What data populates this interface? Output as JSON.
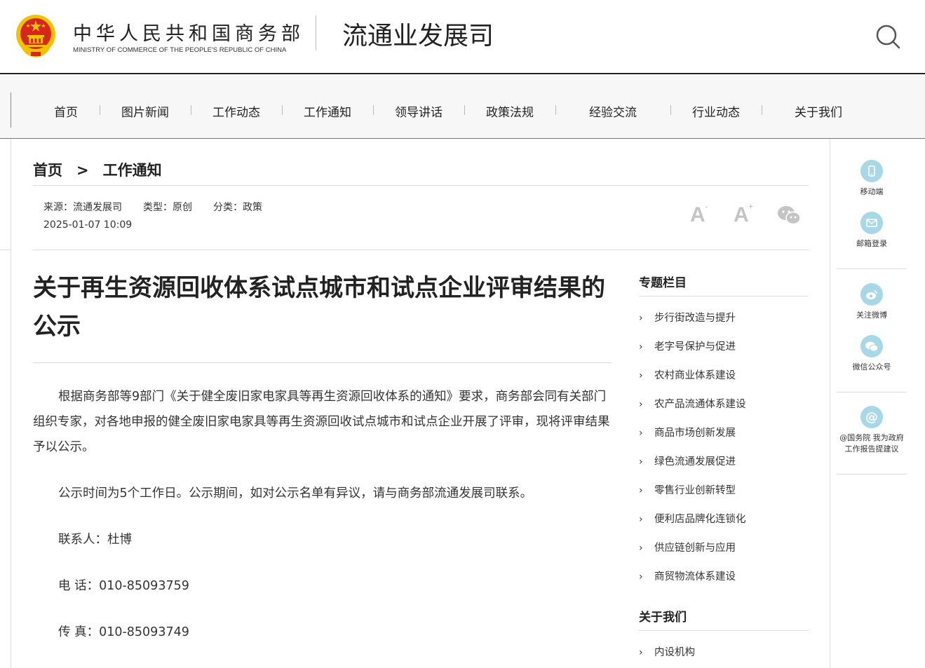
{
  "header": {
    "ministry_cn": "中华人民共和国商务部",
    "ministry_en": "MINISTRY OF COMMERCE OF THE PEOPLE'S REPUBLIC OF CHINA",
    "dept_name": "流通业发展司",
    "search_icon": "search-icon"
  },
  "nav": {
    "items": [
      "首页",
      "图片新闻",
      "工作动态",
      "工作通知",
      "领导讲话",
      "政策法规",
      "经验交流",
      "行业动态",
      "关于我们"
    ]
  },
  "breadcrumb": {
    "home": "首页",
    "separator": ">",
    "current": "工作通知"
  },
  "meta": {
    "source": "来源：流通发展司",
    "type": "类型：原创",
    "category": "分类：政策",
    "date": "2025-01-07 10:09"
  },
  "font_tools": {
    "decrease": "A",
    "decrease_sup": "-",
    "increase": "A",
    "increase_sup": "+",
    "share_icon": "wechat-icon"
  },
  "article": {
    "title": "关于再生资源回收体系试点城市和试点企业评审结果的公示",
    "paragraphs": [
      "根据商务部等9部门《关于健全废旧家电家具等再生资源回收体系的通知》要求，商务部会同有关部门组织专家，对各地申报的健全废旧家电家具等再生资源回收试点城市和试点企业开展了评审，现将评审结果予以公示。",
      "公示时间为5个工作日。公示期间，如对公示名单有异议，请与商务部流通发展司联系。",
      "联系人：杜博",
      "电 话：010-85093759",
      "传 真：010-85093749"
    ]
  },
  "sidebar": {
    "topics_heading": "专题栏目",
    "topics": [
      "步行街改造与提升",
      "老字号保护与促进",
      "农村商业体系建设",
      "农产品流通体系建设",
      "商品市场创新发展",
      "绿色流通发展促进",
      "零售行业创新转型",
      "便利店品牌化连锁化",
      "供应链创新与应用",
      "商贸物流体系建设"
    ],
    "about_heading": "关于我们",
    "about": [
      "内设机构"
    ]
  },
  "toolbar": {
    "mobile": "移动端",
    "mail": "邮箱登录",
    "weibo": "关注微博",
    "wechat": "微信公众号",
    "suggest_line1": "@国务院 我为政府",
    "suggest_line2": "工作报告提建议",
    "suggest_symbol": "@"
  },
  "colors": {
    "accent_circle": "#a8d8e6",
    "emblem_red": "#d7261e",
    "emblem_gold": "#f2c200"
  }
}
